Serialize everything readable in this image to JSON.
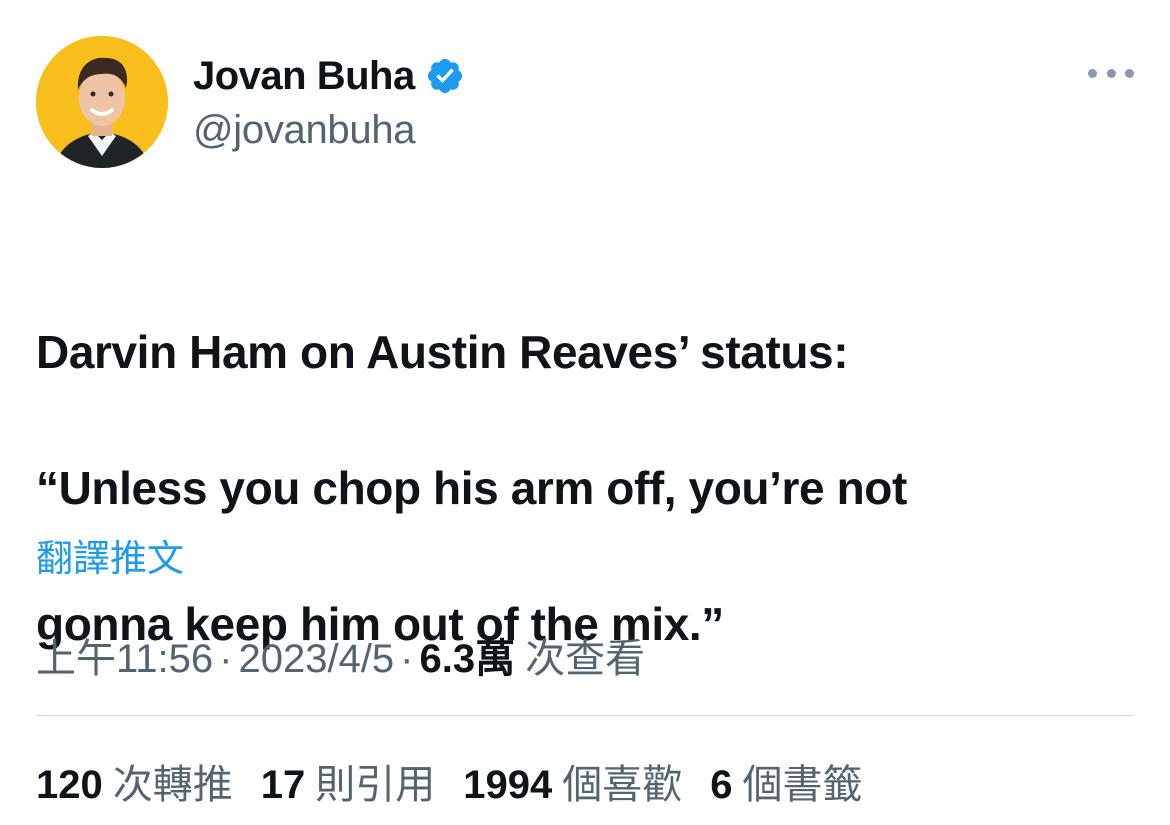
{
  "author": {
    "display_name": "Jovan Buha",
    "handle": "@jovanbuha",
    "verified": true
  },
  "tweet": {
    "text_lines": [
      "Darvin Ham on Austin Reaves’ status:",
      "“Unless you chop his arm off, you’re not",
      "gonna keep him out of the mix.”"
    ],
    "translate_label": "翻譯推文"
  },
  "meta": {
    "time": "上午11:56",
    "separator": "·",
    "date": "2023/4/5",
    "views_count": "6.3萬",
    "views_label": "次查看"
  },
  "stats": {
    "retweets": {
      "count": "120",
      "label": "次轉推"
    },
    "quotes": {
      "count": "17",
      "label": "則引用"
    },
    "likes": {
      "count": "1994",
      "label": "個喜歡"
    },
    "bookmarks": {
      "count": "6",
      "label": "個書籤"
    }
  },
  "colors": {
    "accent": "#1d9bf0",
    "avatar_bg": "#f8be1c",
    "secondary_text": "#536471",
    "primary_text": "#0f1419"
  },
  "icons": {
    "verified": "verified-badge-icon",
    "more": "more-options-icon"
  }
}
